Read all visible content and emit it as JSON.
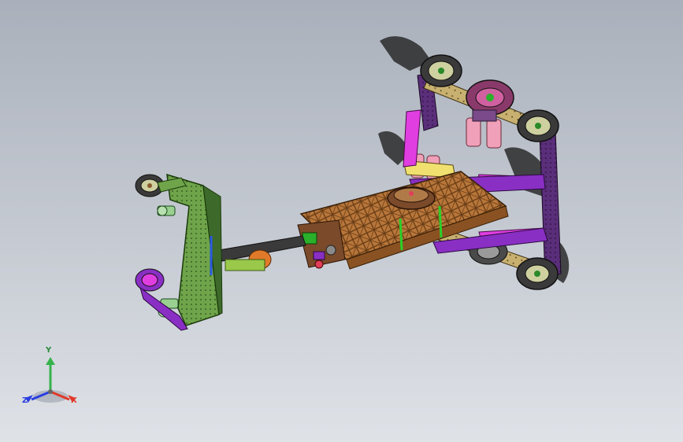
{
  "viewport": {
    "background_top": "#aab0bb",
    "background_bottom": "#dfe2e7"
  },
  "axis_triad": {
    "y_label": "Y",
    "z_label": "Z",
    "x_label": "X",
    "colors": {
      "x": "#e0302a",
      "y": "#36b24a",
      "z": "#2a3ee0"
    }
  },
  "model": {
    "part_colors": {
      "truss": "#b8763a",
      "plate": "#6fa44a",
      "bracket": "#8a2fc4",
      "magenta": "#e03ee0",
      "pink": "#f0a0b8",
      "yellow": "#f0e070",
      "wheel": "#4a4a4a",
      "tan": "#c8b070"
    }
  }
}
